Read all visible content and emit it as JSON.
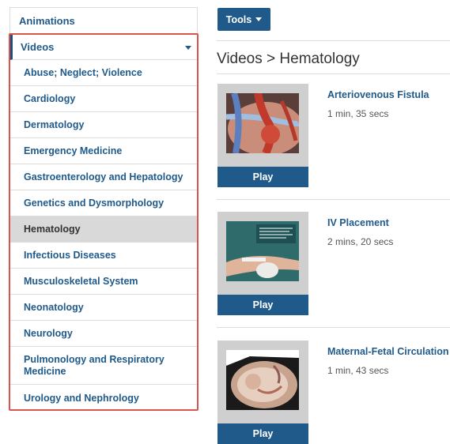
{
  "sidebar": {
    "animations_label": "Animations",
    "videos_label": "Videos",
    "categories": [
      "Abuse; Neglect; Violence",
      "Cardiology",
      "Dermatology",
      "Emergency Medicine",
      "Gastroenterology and Hepatology",
      "Genetics and Dysmorphology",
      "Hematology",
      "Infectious Diseases",
      "Musculoskeletal System",
      "Neonatology",
      "Neurology",
      "Pulmonology and Respiratory Medicine",
      "Urology and Nephrology"
    ],
    "active_category": "Hematology"
  },
  "toolbar": {
    "tools_label": "Tools"
  },
  "main": {
    "breadcrumb_title": "Videos > Hematology",
    "videos": [
      {
        "title": "Arteriovenous Fistula",
        "duration": "1 min, 35 secs",
        "play_label": "Play"
      },
      {
        "title": "IV Placement",
        "duration": "2 mins, 20 secs",
        "play_label": "Play"
      },
      {
        "title": "Maternal-Fetal Circulation",
        "duration": "1 min, 43 secs",
        "play_label": "Play"
      }
    ]
  },
  "colors": {
    "brand_blue": "#1f5a8a",
    "highlight_red": "#d9534f",
    "active_bg": "#d9d9d9"
  }
}
